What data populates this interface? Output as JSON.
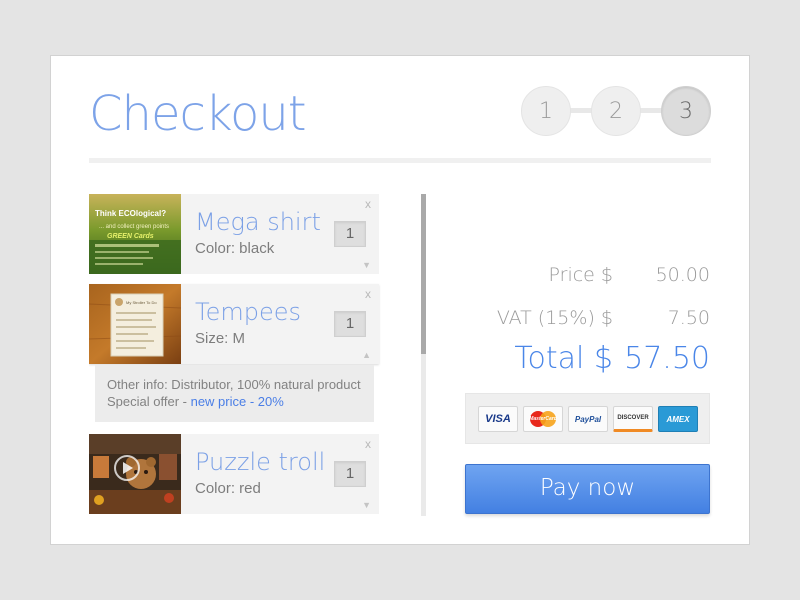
{
  "header": {
    "title": "Checkout",
    "steps": [
      "1",
      "2",
      "3"
    ],
    "active_step": 3
  },
  "items": [
    {
      "name": "Mega shirt",
      "attribute": "Color: black",
      "quantity": "1",
      "remove": "x",
      "thumb_text": [
        "Think ECOlogical?",
        "... and collect green points",
        "GREEN Cards"
      ]
    },
    {
      "name": "Tempees",
      "attribute": "Size: M",
      "quantity": "1",
      "remove": "x",
      "thumb_text": [
        "My Stroller To Do"
      ],
      "expanded_info": {
        "other_info": "Other info: Distributor, 100% natural product",
        "offer_prefix": "Special offer - ",
        "offer_link": "new price - 20%"
      }
    },
    {
      "name": "Puzzle troll",
      "attribute": "Color: red",
      "quantity": "1",
      "remove": "x"
    }
  ],
  "summary": {
    "price_label": "Price $",
    "price_value": "50.00",
    "vat_label": "VAT (15%) $",
    "vat_value": "7.50",
    "total_label": "Total $",
    "total_value": "57.50"
  },
  "payment_methods": [
    {
      "name": "VISA",
      "icon": "visa-icon",
      "color": "#1a3a8a"
    },
    {
      "name": "MasterCard",
      "icon": "mastercard-icon",
      "color": "#e8531c"
    },
    {
      "name": "PayPal",
      "icon": "paypal-icon",
      "color": "#1f4f9a"
    },
    {
      "name": "DISCOVER",
      "icon": "discover-icon",
      "color": "#333333"
    },
    {
      "name": "AMEX",
      "icon": "amex-icon",
      "color": "#ffffff"
    }
  ],
  "pay_button": "Pay now",
  "colors": {
    "accent": "#7da3e8",
    "total": "#4a86e8",
    "button": "#4a86e8",
    "link": "#4a7ee6"
  }
}
